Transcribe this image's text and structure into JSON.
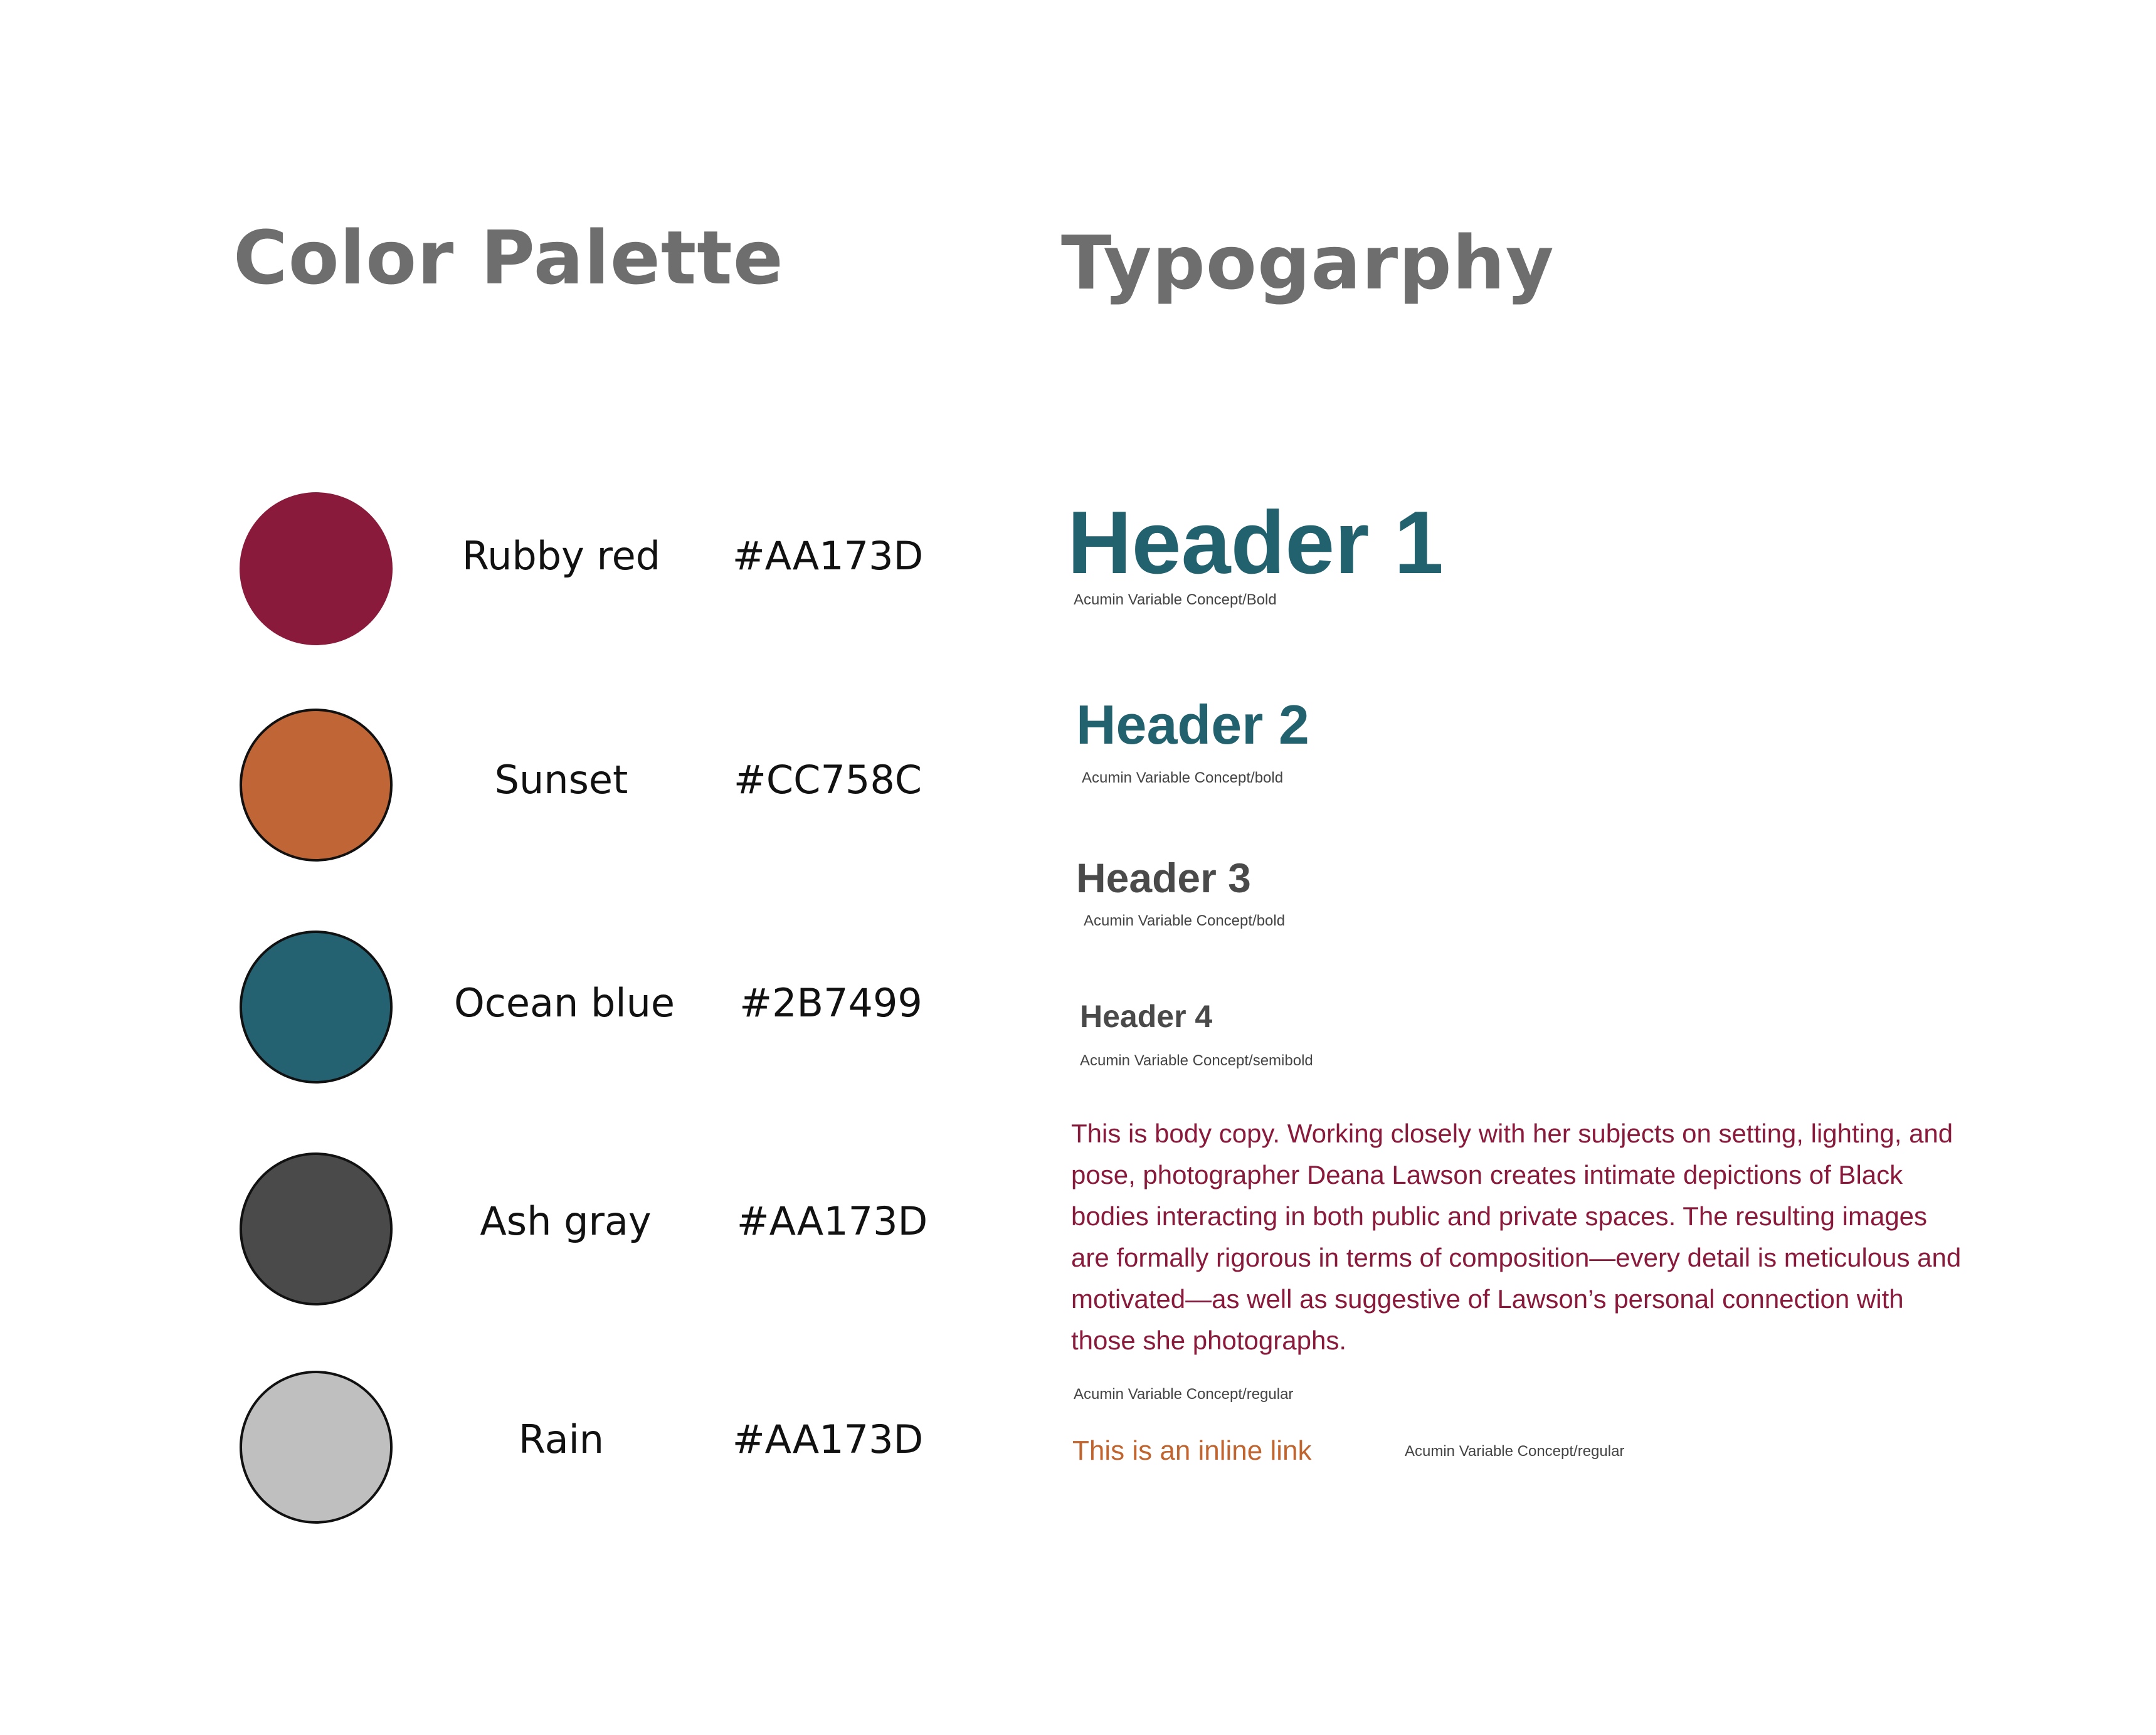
{
  "palette": {
    "title": "Color Palette",
    "colors": [
      {
        "name": "Rubby red",
        "hex": "#AA173D",
        "swatch": "#8a1a3c"
      },
      {
        "name": "Sunset",
        "hex": "#CC758C",
        "swatch": "#c06535"
      },
      {
        "name": "Ocean blue",
        "hex": "#2B7499",
        "swatch": "#246272"
      },
      {
        "name": "Ash gray",
        "hex": "#AA173D",
        "swatch": "#4a4a4a"
      },
      {
        "name": "Rain",
        "hex": "#AA173D",
        "swatch": "#bfbfbf"
      }
    ]
  },
  "typography": {
    "title": "Typogarphy",
    "h1": {
      "label": "Header 1",
      "caption": "Acumin Variable Concept/Bold"
    },
    "h2": {
      "label": "Header 2",
      "caption": "Acumin Variable Concept/bold"
    },
    "h3": {
      "label": "Header 3",
      "caption": "Acumin Variable Concept/bold"
    },
    "h4": {
      "label": "Header 4",
      "caption": "Acumin Variable Concept/semibold"
    },
    "body": {
      "text": "This is body copy. Working closely with her subjects on setting, lighting, and pose, photographer Deana Lawson creates intimate depictions of Black bodies interacting in both public and private spaces. The resulting images are formally rigorous in terms of composition—every detail is meticulous and motivated—as well as suggestive of Lawson’s personal connection with those she photographs.",
      "caption": "Acumin Variable Concept/regular"
    },
    "link": {
      "label": "This is an inline link",
      "caption": "Acumin Variable Concept/regular"
    }
  },
  "colors": {
    "title_gray": "#6e6e6e",
    "header_teal": "#22626f",
    "header_gray": "#4a4a4a",
    "body_red": "#8a1a3c",
    "link_orange": "#c0652f"
  }
}
